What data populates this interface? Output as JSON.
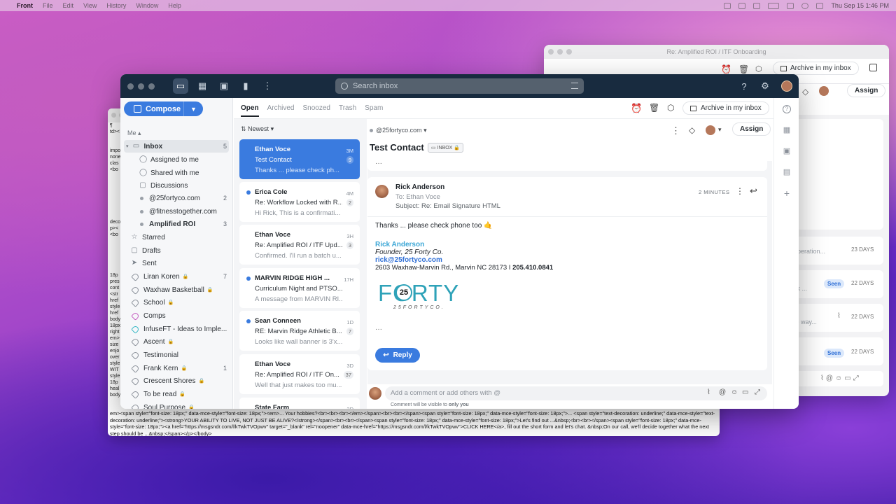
{
  "menubar": {
    "apple": "",
    "app": "Front",
    "items": [
      "File",
      "Edit",
      "View",
      "History",
      "Window",
      "Help"
    ],
    "clock": "Thu Sep 15  1:46 PM"
  },
  "back_window": {
    "title": "Re: Amplified ROI / ITF Onboarding",
    "archive_label": "Archive in my inbox",
    "assign_label": "Assign",
    "rows": [
      {
        "snippet": "of operation...",
        "time": "23 DAYS",
        "seen": ""
      },
      {
        "snippet": "work ...",
        "time": "22 DAYS",
        "seen": "Seen"
      },
      {
        "snippet": "cure way...",
        "time": "22 DAYS",
        "seen": ""
      },
      {
        "snippet": "",
        "time": "22 DAYS",
        "seen": "Seen"
      }
    ]
  },
  "code_window": {
    "left_col": [
      "¶",
      "td><",
      "impo",
      "none",
      "clas",
      "<bo",
      "deco",
      "p><",
      "<bo",
      "18p",
      "pres",
      "cont",
      "<str",
      "href",
      "style",
      "href",
      "body",
      "18px",
      "right",
      "em>",
      "size",
      "enjo",
      "over",
      "style",
      "WIT",
      "style",
      "18p",
      "heal",
      "body"
    ],
    "bottom": "em><span style=\"font-size: 18px;\" data-mce-style=\"font-size: 18px;\"><em>... Your hobbies?<br><br><br></em></span><br><br></span><span style=\"font-size: 18px;\" data-mce-style=\"font-size: 18px;\">... <span style=\"text-decoration: underline;\" data-mce-style=\"text-decoration: underline;\"><strong>YOUR ABILITY TO LIVE, NOT JUST BE ALIVE?</strong></span><br><br></span><span style=\"font-size: 18px;\" data-mce-style=\"font-size: 18px;\">Let's find out ...&nbsp;<br><br></span><span style=\"font-size: 18px;\" data-mce-style=\"font-size: 18px;\"><a href=\"https://msgsndr.com/l/kTwkTVOpwv\" target=\"_blank\" rel=\"noopener\" data-mce-href=\"https://msgsndr.com/l/kTwkTVOpwv\">CLICK HERE</a>, fill out the short form and let's chat. &nbsp;On our call, we'll decide together what the next step should be ...&nbsp;</span></p></body>"
  },
  "toolbar": {
    "search_placeholder": "Search inbox"
  },
  "sidebar": {
    "compose": "Compose",
    "me": "Me ▴",
    "items": [
      {
        "label": "Inbox",
        "count": "5",
        "kind": "inbox",
        "bold": true
      },
      {
        "label": "Assigned to me",
        "count": "",
        "kind": "sub"
      },
      {
        "label": "Shared with me",
        "count": "",
        "kind": "sub"
      },
      {
        "label": "Discussions",
        "count": "",
        "kind": "sub"
      },
      {
        "label": "@25fortyco.com",
        "count": "2",
        "kind": "dot"
      },
      {
        "label": "@fitnesstogether.com",
        "count": "",
        "kind": "dot"
      },
      {
        "label": "Amplified ROI",
        "count": "3",
        "kind": "dot",
        "bold": true
      },
      {
        "label": "Starred",
        "count": "",
        "kind": "top"
      },
      {
        "label": "Drafts",
        "count": "",
        "kind": "top"
      },
      {
        "label": "Sent",
        "count": "",
        "kind": "top"
      },
      {
        "label": "Liran Koren",
        "count": "7",
        "kind": "tag",
        "lock": true
      },
      {
        "label": "Waxhaw Basketball",
        "count": "",
        "kind": "tag",
        "lock": true
      },
      {
        "label": "School",
        "count": "",
        "kind": "tag",
        "lock": true
      },
      {
        "label": "Comps",
        "count": "",
        "kind": "tag",
        "color": "#c45cc0"
      },
      {
        "label": "InfuseFT - Ideas to Imple...",
        "count": "",
        "kind": "tag",
        "color": "#36b7c4"
      },
      {
        "label": "Ascent",
        "count": "",
        "kind": "tag",
        "lock": true
      },
      {
        "label": "Testimonial",
        "count": "",
        "kind": "tag"
      },
      {
        "label": "Frank Kern",
        "count": "1",
        "kind": "tag",
        "lock": true
      },
      {
        "label": "Crescent Shores",
        "count": "",
        "kind": "tag",
        "lock": true
      },
      {
        "label": "To be read",
        "count": "",
        "kind": "tag",
        "lock": true
      },
      {
        "label": "Soul Purpose",
        "count": "",
        "kind": "tag",
        "lock": true
      }
    ]
  },
  "tabs": [
    "Open",
    "Archived",
    "Snoozed",
    "Trash",
    "Spam"
  ],
  "list": {
    "sort": "Newest",
    "cards": [
      {
        "from": "Ethan Voce",
        "subject": "Test Contact",
        "snippet": "Thanks ... please check ph...",
        "time": "3M",
        "count": "9",
        "selected": true,
        "unread": false
      },
      {
        "from": "Erica Cole",
        "subject": "Re: Workflow Locked with R...",
        "snippet": "Hi Rick, This is a confirmati...",
        "time": "4M",
        "count": "2",
        "unread": true
      },
      {
        "from": "Ethan Voce",
        "subject": "Re: Amplified ROI / ITF Upd...",
        "snippet": "Confirmed. I'll run a batch u...",
        "time": "3H",
        "count": "3",
        "unread": false
      },
      {
        "from": "MARVIN RIDGE HIGH ...",
        "subject": "Curriculum Night and PTSO...",
        "snippet": "A message from MARVIN RI...",
        "time": "17H",
        "count": "",
        "unread": true
      },
      {
        "from": "Sean Conneen",
        "subject": "RE: Marvin Ridge Athletic B...",
        "snippet": "Looks like wall banner is 3'x...",
        "time": "1D",
        "count": "7",
        "unread": true
      },
      {
        "from": "Ethan Voce",
        "subject": "Re: Amplified ROI / ITF On...",
        "snippet": "Well that just makes too mu...",
        "time": "3D",
        "count": "37",
        "unread": false
      },
      {
        "from": "State Farm",
        "subject": "",
        "snippet": "",
        "time": "3D",
        "count": "",
        "unread": false
      }
    ]
  },
  "conversation": {
    "inbox_account": "@25fortyco.com",
    "title": "Test Contact",
    "badge": "INBOX",
    "archive_label": "Archive in my inbox",
    "assign_label": "Assign",
    "ellipsis": "···",
    "message": {
      "sender": "Rick Anderson",
      "to": "To: Ethan Voce",
      "subject": "Subject: Re: Email Signature HTML",
      "time": "2 MINUTES",
      "body": "Thanks ... please check phone too 🤙",
      "sig_name": "Rick Anderson",
      "sig_title": "Founder, 25 Forty Co.",
      "sig_email": "rick@25fortyco.com",
      "sig_address": "2603 Waxhaw-Marvin Rd., Marvin NC 28173 I ",
      "sig_phone": "205.410.0841",
      "logo_word": "FORTY",
      "logo_num": "25",
      "logo_sub": "25FORTYCO.",
      "ellipsis": "···",
      "reply": "Reply"
    },
    "comment_placeholder": "Add a comment or add others with @",
    "comment_note": "Comment will be visible to ",
    "comment_note_bold": "only you"
  }
}
